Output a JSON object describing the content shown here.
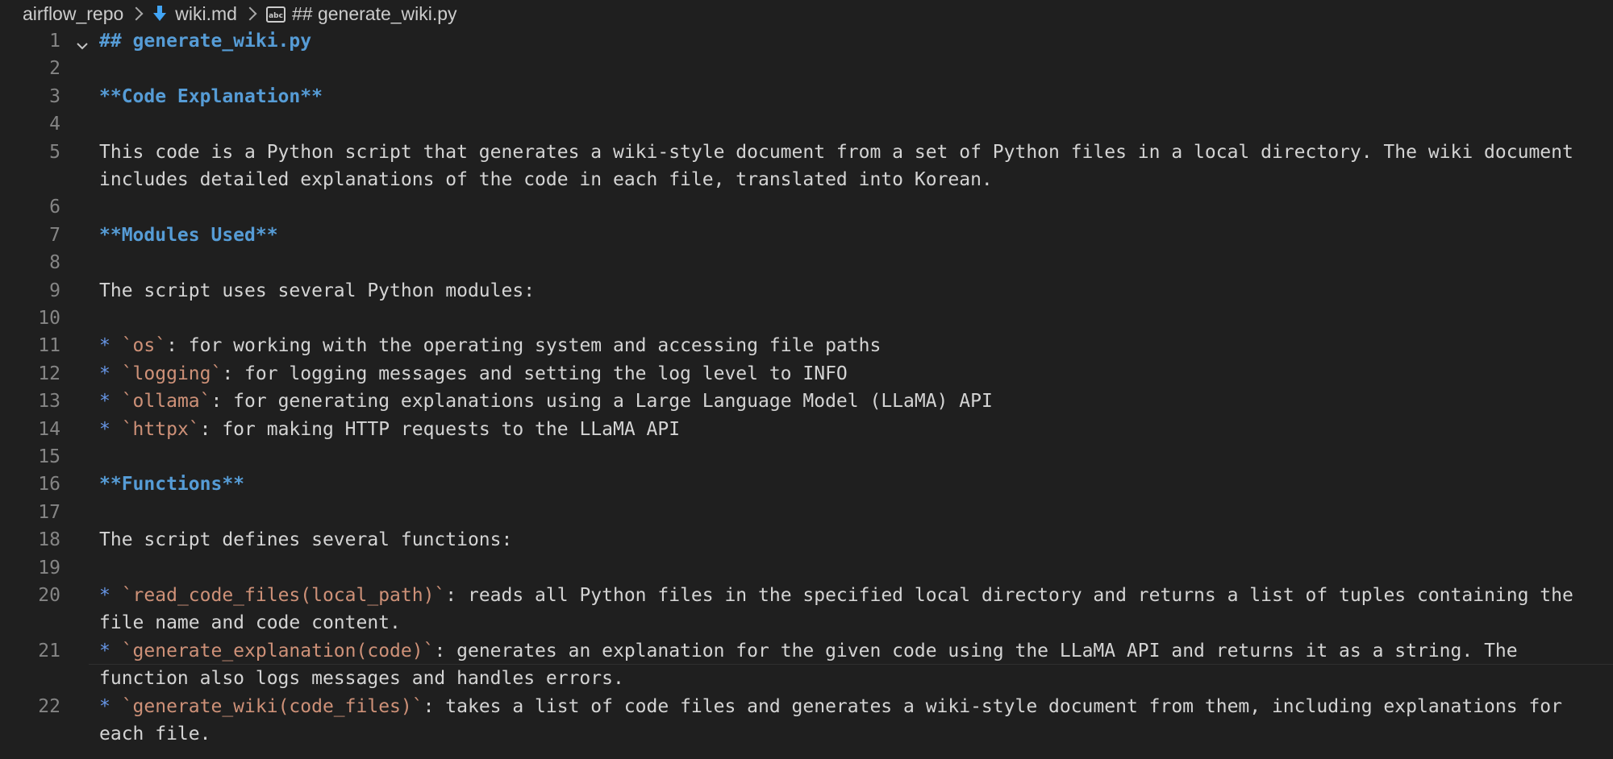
{
  "breadcrumb": {
    "folder": "airflow_repo",
    "file": "wiki.md",
    "symbol": "## generate_wiki.py",
    "file_icon": "markdown-arrow-icon",
    "symbol_icon": "string-symbol-icon"
  },
  "editor": {
    "lines": [
      {
        "num": "1",
        "fold": true,
        "rows": [
          [
            {
              "t": "head",
              "v": "## generate_wiki.py"
            }
          ]
        ]
      },
      {
        "num": "2",
        "rows": [
          []
        ]
      },
      {
        "num": "3",
        "rows": [
          [
            {
              "t": "bold",
              "v": "**Code Explanation**"
            }
          ]
        ]
      },
      {
        "num": "4",
        "rows": [
          []
        ]
      },
      {
        "num": "5",
        "rows": [
          [
            {
              "t": "text",
              "v": "This code is a Python script that generates a wiki-style document from a set of Python files in a local directory. The wiki document"
            }
          ],
          [
            {
              "t": "text",
              "v": "includes detailed explanations of the code in each file, translated into Korean."
            }
          ]
        ]
      },
      {
        "num": "6",
        "rows": [
          []
        ]
      },
      {
        "num": "7",
        "rows": [
          [
            {
              "t": "bold",
              "v": "**Modules Used**"
            }
          ]
        ]
      },
      {
        "num": "8",
        "rows": [
          []
        ]
      },
      {
        "num": "9",
        "rows": [
          [
            {
              "t": "text",
              "v": "The script uses several Python modules:"
            }
          ]
        ]
      },
      {
        "num": "10",
        "rows": [
          []
        ]
      },
      {
        "num": "11",
        "rows": [
          [
            {
              "t": "bullet",
              "v": "* "
            },
            {
              "t": "code",
              "v": "`os`"
            },
            {
              "t": "text",
              "v": ": for working with the operating system and accessing file paths"
            }
          ]
        ]
      },
      {
        "num": "12",
        "rows": [
          [
            {
              "t": "bullet",
              "v": "* "
            },
            {
              "t": "code",
              "v": "`logging`"
            },
            {
              "t": "text",
              "v": ": for logging messages and setting the log level to INFO"
            }
          ]
        ]
      },
      {
        "num": "13",
        "rows": [
          [
            {
              "t": "bullet",
              "v": "* "
            },
            {
              "t": "code",
              "v": "`ollama`"
            },
            {
              "t": "text",
              "v": ": for generating explanations using a Large Language Model (LLaMA) API"
            }
          ]
        ]
      },
      {
        "num": "14",
        "rows": [
          [
            {
              "t": "bullet",
              "v": "* "
            },
            {
              "t": "code",
              "v": "`httpx`"
            },
            {
              "t": "text",
              "v": ": for making HTTP requests to the LLaMA API"
            }
          ]
        ]
      },
      {
        "num": "15",
        "rows": [
          []
        ]
      },
      {
        "num": "16",
        "rows": [
          [
            {
              "t": "bold",
              "v": "**Functions**"
            }
          ]
        ]
      },
      {
        "num": "17",
        "rows": [
          []
        ]
      },
      {
        "num": "18",
        "rows": [
          [
            {
              "t": "text",
              "v": "The script defines several functions:"
            }
          ]
        ]
      },
      {
        "num": "19",
        "rows": [
          []
        ]
      },
      {
        "num": "20",
        "rows": [
          [
            {
              "t": "bullet",
              "v": "* "
            },
            {
              "t": "code",
              "v": "`read_code_files(local_path)`"
            },
            {
              "t": "text",
              "v": ": reads all Python files in the specified local directory and returns a list of tuples containing the"
            }
          ],
          [
            {
              "t": "text",
              "v": "file name and code content."
            }
          ]
        ]
      },
      {
        "num": "21",
        "current": true,
        "rows": [
          [
            {
              "t": "bullet",
              "v": "* "
            },
            {
              "t": "code",
              "v": "`generate_explanation(code)`"
            },
            {
              "t": "text",
              "v": ": generates an explanation for the given code using the LLaMA API and returns it as a string. The"
            }
          ],
          [
            {
              "t": "text",
              "v": "function also logs messages and handles errors."
            }
          ]
        ]
      },
      {
        "num": "22",
        "rows": [
          [
            {
              "t": "bullet",
              "v": "* "
            },
            {
              "t": "code",
              "v": "`generate_wiki(code_files)`"
            },
            {
              "t": "text",
              "v": ": takes a list of code files and generates a wiki-style document from them, including explanations for"
            }
          ],
          [
            {
              "t": "text",
              "v": "each file."
            }
          ]
        ]
      }
    ]
  }
}
